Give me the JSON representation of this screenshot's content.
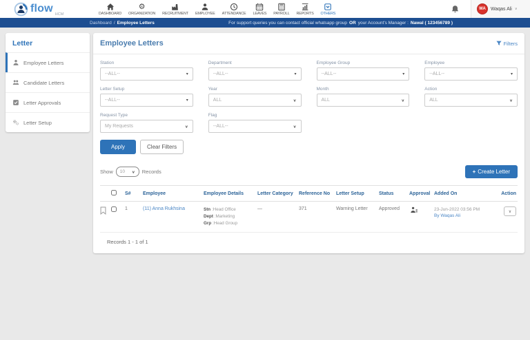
{
  "brand": {
    "name": "flow",
    "suffix": "HCM"
  },
  "topnav": {
    "items": [
      {
        "label": "DASHBOARD"
      },
      {
        "label": "ORGANIZATION"
      },
      {
        "label": "RECRUITMENT"
      },
      {
        "label": "EMPLOYEE"
      },
      {
        "label": "ATTENDANCE"
      },
      {
        "label": "LEAVES"
      },
      {
        "label": "PAYROLL"
      },
      {
        "label": "REPORTS"
      },
      {
        "label": "OTHERS"
      }
    ],
    "user": {
      "initials": "WA",
      "name": "Waqas Ali"
    }
  },
  "breadcrumb": {
    "parent": "Dashboard",
    "separator": "/",
    "current": "Employee Letters"
  },
  "notice": {
    "text_before": "For support queries you can contact official whatsapp group",
    "bold_or": "OR",
    "text_mid": "your Account's Manager :",
    "bold_contact": "Nawal ( 123456789 )"
  },
  "sidebar": {
    "title": "Letter",
    "items": [
      {
        "label": "Employee Letters"
      },
      {
        "label": "Candidate Letters"
      },
      {
        "label": "Letter Approvals"
      },
      {
        "label": "Letter Setup"
      }
    ]
  },
  "main": {
    "title": "Employee Letters",
    "filters_link": "Filters",
    "filters": {
      "station": {
        "label": "Station",
        "value": "--ALL--"
      },
      "department": {
        "label": "Department",
        "value": "--ALL--"
      },
      "employee_group": {
        "label": "Employee Group",
        "value": "--ALL--"
      },
      "employee": {
        "label": "Employee",
        "value": "--ALL--"
      },
      "letter_setup": {
        "label": "Letter Setup",
        "value": "--ALL--"
      },
      "year": {
        "label": "Year",
        "value": "ALL"
      },
      "month": {
        "label": "Month",
        "value": "ALL"
      },
      "action": {
        "label": "Action",
        "value": "ALL"
      },
      "request_type": {
        "label": "Request Type",
        "value": "My Requests"
      },
      "flag": {
        "label": "Flag",
        "value": "--ALL--"
      }
    },
    "apply_button": "Apply",
    "clear_button": "Clear Filters",
    "show": {
      "label": "Show",
      "page_size": "10",
      "records": "Records"
    },
    "create_button": {
      "icon": "+",
      "label": "Create Letter"
    },
    "table": {
      "headers": {
        "sn": "S#",
        "employee": "Employee",
        "details": "Employee Details",
        "category": "Letter Category",
        "reference": "Reference No",
        "setup": "Letter Setup",
        "status": "Status",
        "approval": "Approval",
        "added": "Added On",
        "action": "Action"
      },
      "rows": [
        {
          "sn": "1",
          "employee": "(11) Anna Rukhsina",
          "details": {
            "stn_label": "Stn",
            "stn": ":Head Office",
            "dept_label": "Dept",
            "dept": ":Marketing",
            "grp_label": "Grp",
            "grp": ":Head Group"
          },
          "category": "—",
          "reference": "371",
          "setup": "Warning Letter",
          "status": "Approved",
          "added_date": "23-Jun-2022 03:56 PM",
          "added_by": "By Waqas Ali"
        }
      ],
      "footer": "Records 1 - 1 of 1"
    }
  },
  "colors": {
    "primary": "#2e73b8",
    "breadcrumb_bar": "#1d4e91",
    "avatar": "#d8322c"
  }
}
